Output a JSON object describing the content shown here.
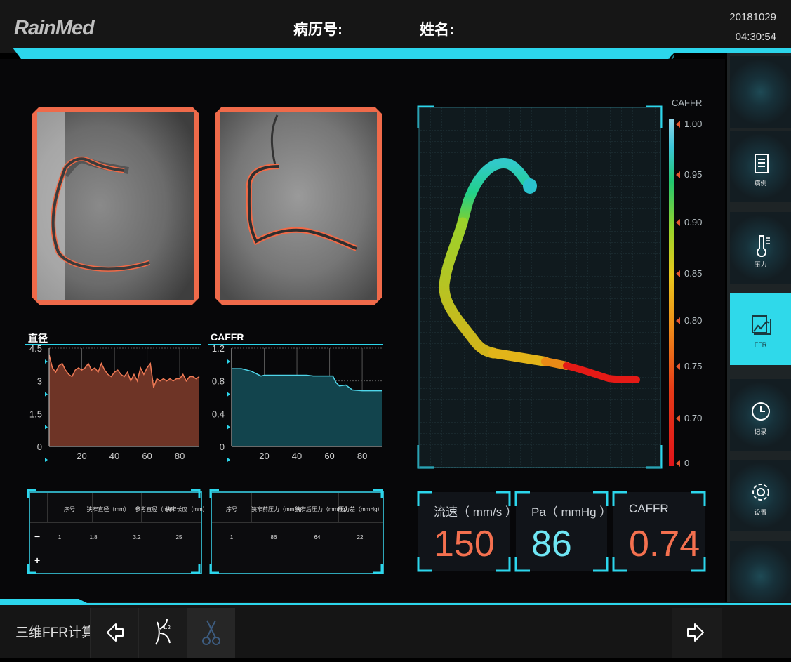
{
  "header": {
    "logo": "RainMed",
    "record_label": "病历号:",
    "name_label": "姓名:",
    "date": "20181029",
    "time": "04:30:54"
  },
  "charts": {
    "diameter": {
      "title": "直径",
      "type": "area",
      "y_ticks": [
        "4.5",
        "3",
        "1.5",
        "0"
      ],
      "x_ticks": [
        "20",
        "40",
        "60",
        "80"
      ],
      "xlim": [
        0,
        92
      ],
      "ylim": [
        0,
        4.5
      ],
      "x": [
        0,
        2,
        4,
        6,
        8,
        10,
        12,
        14,
        16,
        18,
        20,
        22,
        24,
        26,
        28,
        30,
        32,
        34,
        36,
        38,
        40,
        42,
        44,
        46,
        48,
        50,
        52,
        54,
        56,
        58,
        60,
        62,
        64,
        66,
        68,
        70,
        72,
        74,
        76,
        78,
        80,
        82,
        84,
        86,
        88,
        90,
        92
      ],
      "y": [
        4.2,
        3.6,
        3.4,
        3.7,
        3.8,
        3.5,
        3.3,
        3.2,
        3.5,
        3.6,
        3.5,
        3.6,
        3.8,
        3.5,
        3.6,
        3.4,
        3.8,
        3.5,
        3.3,
        3.2,
        3.4,
        3.5,
        3.3,
        3.2,
        3.4,
        3.0,
        3.3,
        3.0,
        3.6,
        3.3,
        3.6,
        3.8,
        2.7,
        3.1,
        3.0,
        3.1,
        3.0,
        3.1,
        3.0,
        3.1,
        3.1,
        3.3,
        3.0,
        3.2,
        3.2,
        3.1,
        3.2
      ],
      "fill_color": "#6e3426",
      "line_color": "#f07a55"
    },
    "caffr": {
      "title": "CAFFR",
      "type": "area",
      "y_ticks": [
        "1.2",
        "0.8",
        "0.4",
        "0"
      ],
      "x_ticks": [
        "20",
        "40",
        "60",
        "80"
      ],
      "xlim": [
        0,
        92
      ],
      "ylim": [
        0,
        1.2
      ],
      "x": [
        0,
        6,
        12,
        16,
        18,
        20,
        26,
        34,
        40,
        46,
        50,
        56,
        62,
        64,
        66,
        70,
        74,
        80,
        86,
        92
      ],
      "y": [
        0.95,
        0.95,
        0.92,
        0.88,
        0.86,
        0.87,
        0.87,
        0.87,
        0.87,
        0.87,
        0.86,
        0.86,
        0.86,
        0.78,
        0.74,
        0.75,
        0.69,
        0.68,
        0.68,
        0.68
      ],
      "fill_color": "#12444d",
      "line_color": "#4fd6ea"
    }
  },
  "table_left": {
    "headers": [
      "序号",
      "狭窄直径（mm）",
      "参考直径（mm）",
      "狭窄长度（mm）"
    ],
    "rows": [
      [
        "1",
        "1.8",
        "3.2",
        "25"
      ]
    ],
    "minus": "−",
    "plus": "+"
  },
  "table_right": {
    "headers": [
      "序号",
      "狭窄前压力（mmHg）",
      "狭窄后压力（mmHg）",
      "压力差（mmHg）"
    ],
    "rows": [
      [
        "1",
        "86",
        "64",
        "22"
      ]
    ]
  },
  "scale": {
    "title": "CAFFR",
    "ticks": [
      "1.00",
      "0.95",
      "0.90",
      "0.85",
      "0.80",
      "0.75",
      "0.70",
      "0"
    ]
  },
  "metrics": [
    {
      "label": "流速（ mm/s ）",
      "value": "150",
      "color": "#f4704f"
    },
    {
      "label": "Pa（ mmHg ）",
      "value": "86",
      "color": "#6fe6f4"
    },
    {
      "label": "CAFFR",
      "value": "0.74",
      "color": "#f4704f"
    }
  ],
  "sidebar": {
    "items": [
      {
        "label": "",
        "icon": "blank"
      },
      {
        "label": "病例",
        "icon": "document-icon"
      },
      {
        "label": "压力",
        "icon": "thermometer-icon"
      },
      {
        "label": "FFR",
        "icon": "ffr-chart-icon",
        "active": true
      },
      {
        "label": "记录",
        "icon": "clock-icon"
      },
      {
        "label": "设置",
        "icon": "gear-icon"
      },
      {
        "label": "",
        "icon": "blank"
      }
    ]
  },
  "footer": {
    "title": "三维FFR计算",
    "back": "arrow-left-icon",
    "vessel": "vessel-icon",
    "scissors": "scissors-icon",
    "next": "arrow-right-icon"
  }
}
